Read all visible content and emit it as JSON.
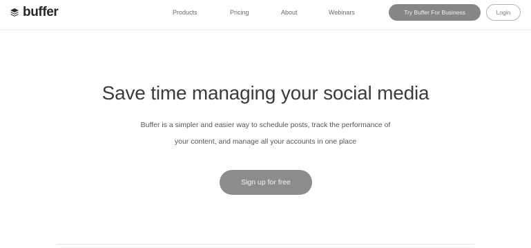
{
  "header": {
    "logo_icon": "buffer-stack-icon",
    "logo_text": "buffer",
    "nav": {
      "products": "Products",
      "pricing": "Pricing",
      "about": "About",
      "webinars": "Webinars"
    },
    "business_button_label": "Try Buffer For Business",
    "login_button_label": "Login"
  },
  "hero": {
    "title": "Save time managing your social media",
    "subtitle_line1": "Buffer is a simpler and easier way to schedule posts, track the performance of",
    "subtitle_line2": "your content, and manage all your accounts in one place",
    "signup_button_label": "Sign up for free"
  },
  "colors": {
    "primary_button": "#868686",
    "text_dark": "#3b3b3b",
    "background": "#ffffff"
  }
}
